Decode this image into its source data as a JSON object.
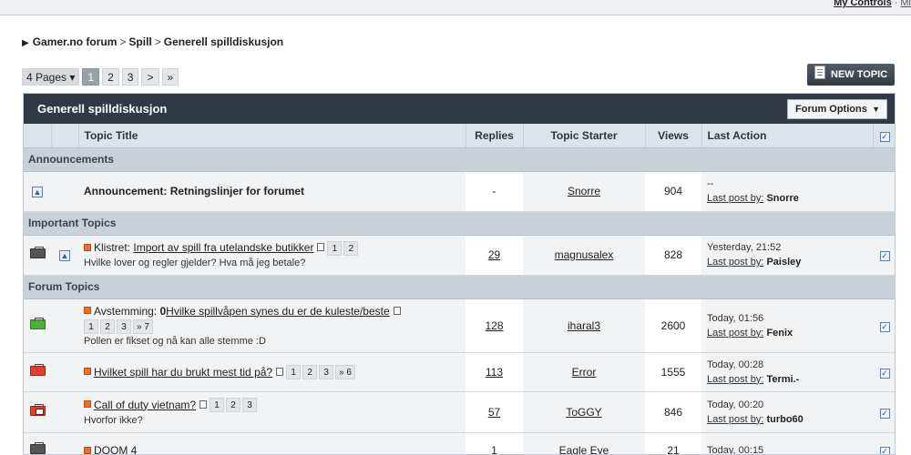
{
  "topbar": {
    "my_controls": "My Controls",
    "sep": "·",
    "more": "Mi"
  },
  "breadcrumb": {
    "items": [
      "Gamer.no forum",
      "Spill",
      "Generell spilldiskusjon"
    ],
    "sep": ">"
  },
  "pagination": {
    "pages_label": "4 Pages",
    "caret": "▾",
    "pages": [
      "1",
      "2",
      "3"
    ],
    "next": ">",
    "last": "»"
  },
  "new_topic": {
    "label": "NEW TOPIC"
  },
  "forum": {
    "title": "Generell spilldiskusjon",
    "options_label": "Forum Options",
    "options_caret": "▼",
    "columns": {
      "topic_title": "Topic Title",
      "replies": "Replies",
      "topic_starter": "Topic Starter",
      "views": "Views",
      "last_action": "Last Action"
    },
    "sections": {
      "announcements": "Announcements",
      "important": "Important Topics",
      "forum": "Forum Topics"
    },
    "announcement": {
      "prefix": "Announcement:",
      "title": "Retningslinjer for forumet",
      "replies": "-",
      "starter": "Snorre",
      "views": "904",
      "last_time": "--",
      "last_by_label": "Last post by:",
      "last_by": "Snorre"
    },
    "pinned": {
      "prefix": "Klistret:",
      "title": "Import av spill fra utelandske butikker",
      "pages": [
        "1",
        "2"
      ],
      "desc": "Hvilke lover og regler gjelder? Hva må jeg betale?",
      "replies": "29",
      "starter": "magnusalex",
      "views": "828",
      "last_time": "Yesterday, 21:52",
      "last_by_label": "Last post by:",
      "last_by": "Paisley"
    },
    "topics": [
      {
        "prefix": "Avstemming:",
        "poll_mark": "0",
        "title": "Hvilke spillvåpen synes du er de kuleste/beste",
        "pages": [
          "1",
          "2",
          "3",
          "» 7"
        ],
        "desc": "Pollen er fikset og nå kan alle stemme :D",
        "replies": "128",
        "starter": "iharal3",
        "views": "2600",
        "last_time": "Today, 01:56",
        "last_by_label": "Last post by:",
        "last_by": "Fenix"
      },
      {
        "title": "Hvilket spill har du brukt mest tid på?",
        "pages": [
          "1",
          "2",
          "3",
          "» 6"
        ],
        "replies": "113",
        "starter": "Error",
        "views": "1555",
        "last_time": "Today, 00:28",
        "last_by_label": "Last post by:",
        "last_by": "Termi.-"
      },
      {
        "title": "Call of duty vietnam?",
        "pages": [
          "1",
          "2",
          "3"
        ],
        "desc": "Hvorfor ikke?",
        "replies": "57",
        "starter": "ToGGY",
        "views": "846",
        "last_time": "Today, 00:20",
        "last_by_label": "Last post by:",
        "last_by": "turbo60"
      },
      {
        "title": "DOOM 4",
        "replies": "1",
        "starter": "Eagle Eye",
        "views": "21",
        "last_time": "Today, 00:15"
      }
    ]
  }
}
